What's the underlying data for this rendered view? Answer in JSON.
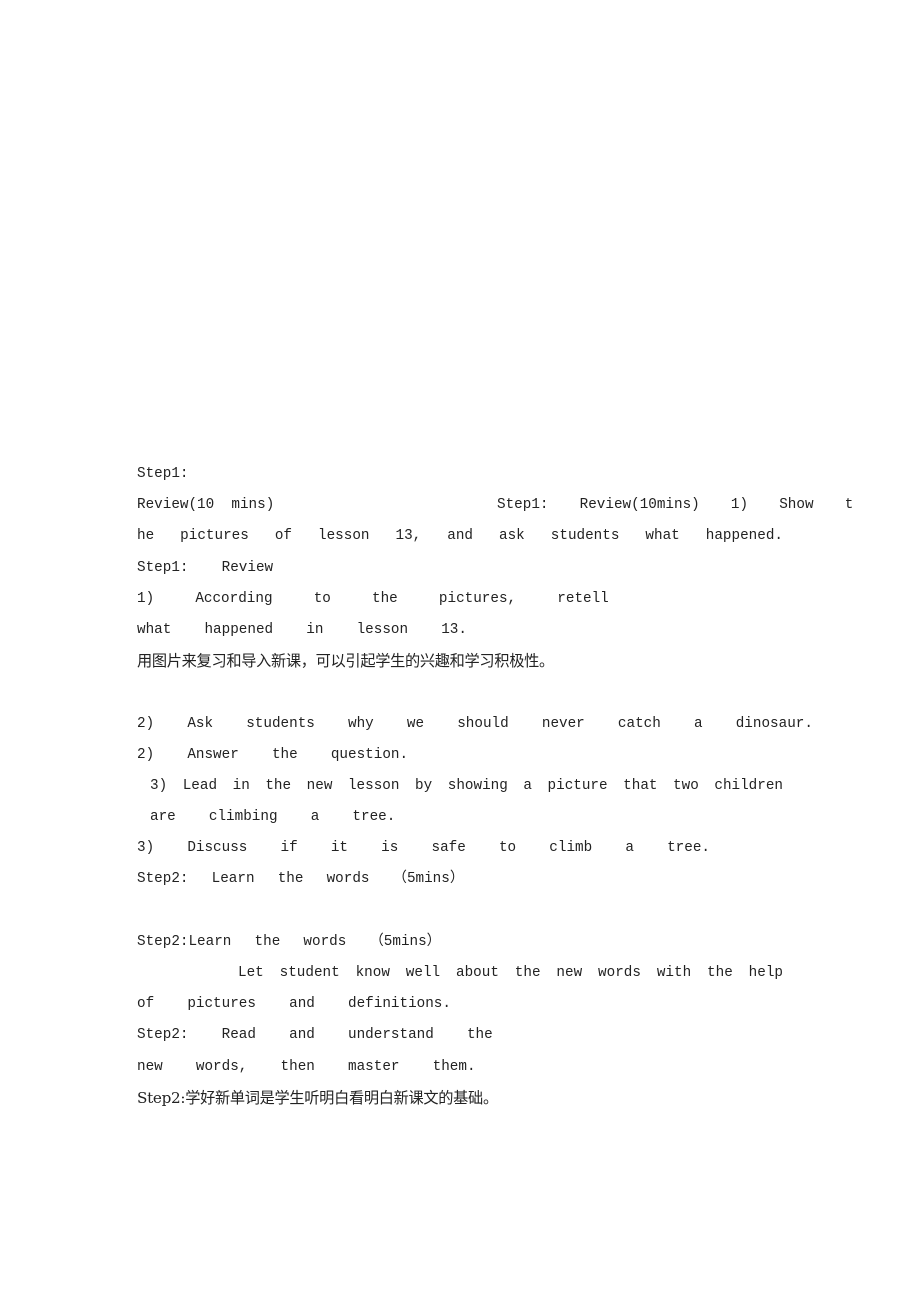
{
  "document": {
    "page_background": "#ffffff",
    "text_color": "#222222",
    "lines": [
      {
        "id": "l1",
        "text": "Step1:"
      },
      {
        "id": "l2a",
        "text": "Review(10  mins)"
      },
      {
        "id": "l2b",
        "text": "Step1:  Review(10mins)  1)  Show  t"
      },
      {
        "id": "l3",
        "text": "he  pictures  of  lesson  13,  and  ask  students  what  happened."
      },
      {
        "id": "l4",
        "text": "Step1:  Review"
      },
      {
        "id": "l5",
        "text": "1)  According  to  the  pictures,  retell"
      },
      {
        "id": "l6",
        "text": "what  happened  in  lesson  13."
      },
      {
        "id": "l7",
        "text": "用图片来复习和导入新课，可以引起学生的兴趣和学习积极性。"
      },
      {
        "id": "l8",
        "text": ""
      },
      {
        "id": "l9",
        "text": "2)  Ask  students  why  we  should  never  catch  a  dinosaur."
      },
      {
        "id": "l10",
        "text": "2)  Answer  the  question."
      },
      {
        "id": "l11",
        "text": "3)  Lead  in  the  new  lesson  by  showing  a  picture  that  two  children"
      },
      {
        "id": "l12",
        "text": "are  climbing  a  tree."
      },
      {
        "id": "l13",
        "text": "3)  Discuss  if  it  is  safe  to  climb  a  tree."
      },
      {
        "id": "l14",
        "text": "Step2:  Learn  the  words  （5mins）"
      },
      {
        "id": "l15",
        "text": ""
      },
      {
        "id": "l16",
        "text": "Step2:Learn  the  words  （5mins）"
      },
      {
        "id": "l17",
        "text": "Let  student  know  well  about  the  new  words  with  the  help"
      },
      {
        "id": "l18",
        "text": "of  pictures  and  definitions."
      },
      {
        "id": "l19",
        "text": "Step2:  Read  and  understand  the"
      },
      {
        "id": "l20",
        "text": "new  words,  then  master  them."
      },
      {
        "id": "l21",
        "text": "Step2:学好新单词是学生听明白看明白新课文的基础。"
      }
    ]
  }
}
